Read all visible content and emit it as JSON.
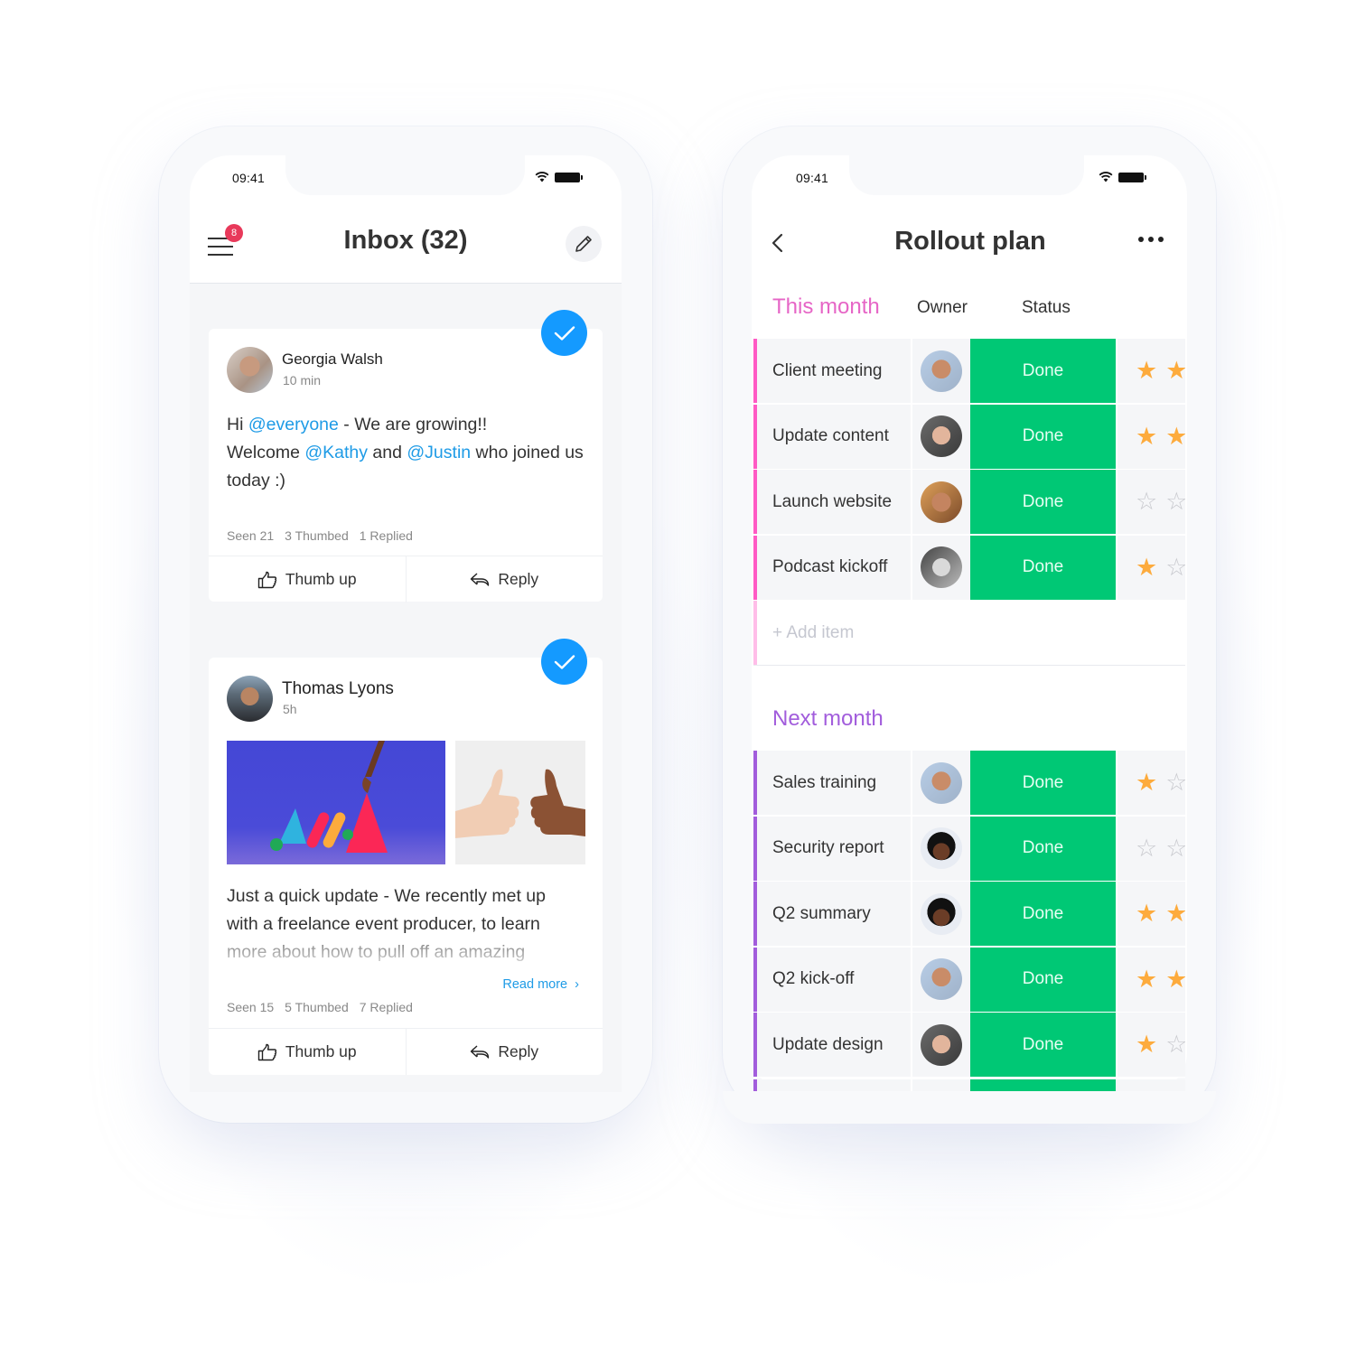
{
  "left_phone": {
    "status_bar": {
      "time": "09:41"
    },
    "header": {
      "menu_badge": "8",
      "title": "Inbox (32)",
      "edit_icon": "pencil-icon"
    },
    "posts": [
      {
        "author": "Georgia Walsh",
        "time": "10 min",
        "body": [
          {
            "text": "Hi "
          },
          {
            "text": "@everyone",
            "mention": true
          },
          {
            "text": " - We are growing!! "
          },
          {
            "text": "Welcome "
          },
          {
            "text": "@Kathy",
            "mention": true
          },
          {
            "text": " and "
          },
          {
            "text": "@Justin",
            "mention": true
          },
          {
            "text": " who joined us today :)"
          }
        ],
        "stats": {
          "seen": "Seen 21",
          "thumbed": "3  Thumbed",
          "replied": "1 Replied"
        },
        "actions": {
          "thumb_up": "Thumb up",
          "reply": "Reply"
        }
      },
      {
        "author": "Thomas Lyons",
        "time": "5h",
        "body_lines": [
          "Just a quick update - We recently met up",
          "with a freelance event producer, to learn",
          "more about how to pull off an amazing"
        ],
        "read_more": "Read more",
        "stats": {
          "seen": "Seen 15",
          "thumbed": "5  Thumbed",
          "replied": "7 Replied"
        },
        "actions": {
          "thumb_up": "Thumb up",
          "reply": "Reply"
        }
      }
    ]
  },
  "right_phone": {
    "status_bar": {
      "time": "09:41"
    },
    "header": {
      "title": "Rollout plan"
    },
    "columns": {
      "owner": "Owner",
      "status": "Status"
    },
    "groups": [
      {
        "title": "This month",
        "color": "#e665c6",
        "accent": "#ff5ac4",
        "items": [
          {
            "name": "Client meeting",
            "status": "Done",
            "rating": 2
          },
          {
            "name": "Update content",
            "status": "Done",
            "rating": 2
          },
          {
            "name": "Launch website",
            "status": "Done",
            "rating": 0
          },
          {
            "name": "Podcast kickoff",
            "status": "Done",
            "rating": 1
          }
        ],
        "add_item": "+ Add item"
      },
      {
        "title": "Next month",
        "color": "#a25ddc",
        "accent": "#a25ddc",
        "items": [
          {
            "name": "Sales training",
            "status": "Done",
            "rating": 1
          },
          {
            "name": "Security report",
            "status": "Done",
            "rating": 0
          },
          {
            "name": "Q2 summary",
            "status": "Done",
            "rating": 2
          },
          {
            "name": "Q2 kick-off",
            "status": "Done",
            "rating": 2
          },
          {
            "name": "Update design",
            "status": "Done",
            "rating": 1
          }
        ]
      }
    ],
    "status_color": "#00c875",
    "star_color": "#fdab3d"
  }
}
